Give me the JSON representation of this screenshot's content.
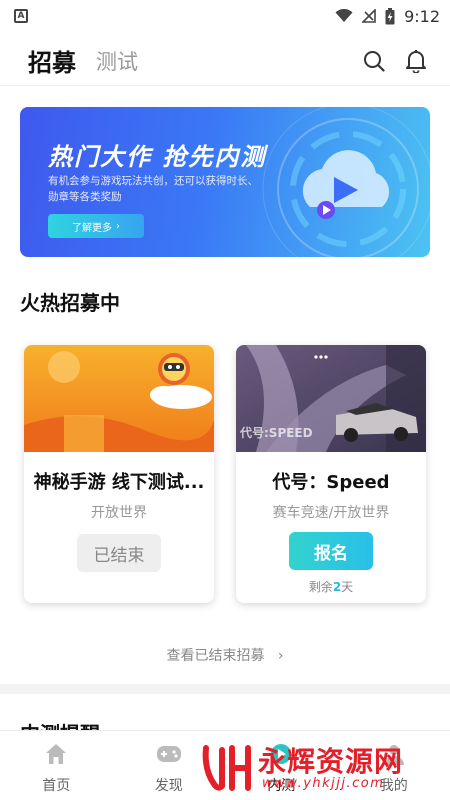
{
  "status_bar": {
    "app_icon_letter": "A",
    "time": "9:12",
    "icons": [
      "wifi-icon",
      "signal-icon",
      "battery-charging-icon"
    ]
  },
  "header": {
    "tab_active": "招募",
    "tab_inactive": "测试",
    "icons": [
      "search-icon",
      "bell-icon"
    ]
  },
  "banner": {
    "title": "热门大作 抢先内测",
    "description": "有机会参与游戏玩法共创，还可以获得时长、勋章等各类奖励",
    "button_label": "了解更多"
  },
  "section_title": "火热招募中",
  "cards": [
    {
      "title": "神秘手游 线下测试...",
      "tag": "开放世界",
      "button_label": "已结束"
    },
    {
      "title": "代号：Speed",
      "tag": "赛车竞速/开放世界",
      "button_label": "报名",
      "remain_prefix": "剩余",
      "remain_days": "2",
      "remain_suffix": "天",
      "image_text": "代号:SPEED"
    }
  ],
  "view_ended": "查看已结束招募",
  "section2_title": "内测提醒",
  "bottom_nav": [
    {
      "label": "首页",
      "icon": "home-icon"
    },
    {
      "label": "发现",
      "icon": "gamepad-icon"
    },
    {
      "label": "内测",
      "icon": "beta-icon"
    },
    {
      "label": "我的",
      "icon": "profile-icon"
    }
  ],
  "watermark": {
    "text": "永辉资源网",
    "url": "www.yhkjjj.com"
  },
  "colors": {
    "accent": "#2ab6e3",
    "banner_start": "#3f59ee",
    "banner_end": "#4cc3f2",
    "watermark_red": "#e3202a"
  }
}
